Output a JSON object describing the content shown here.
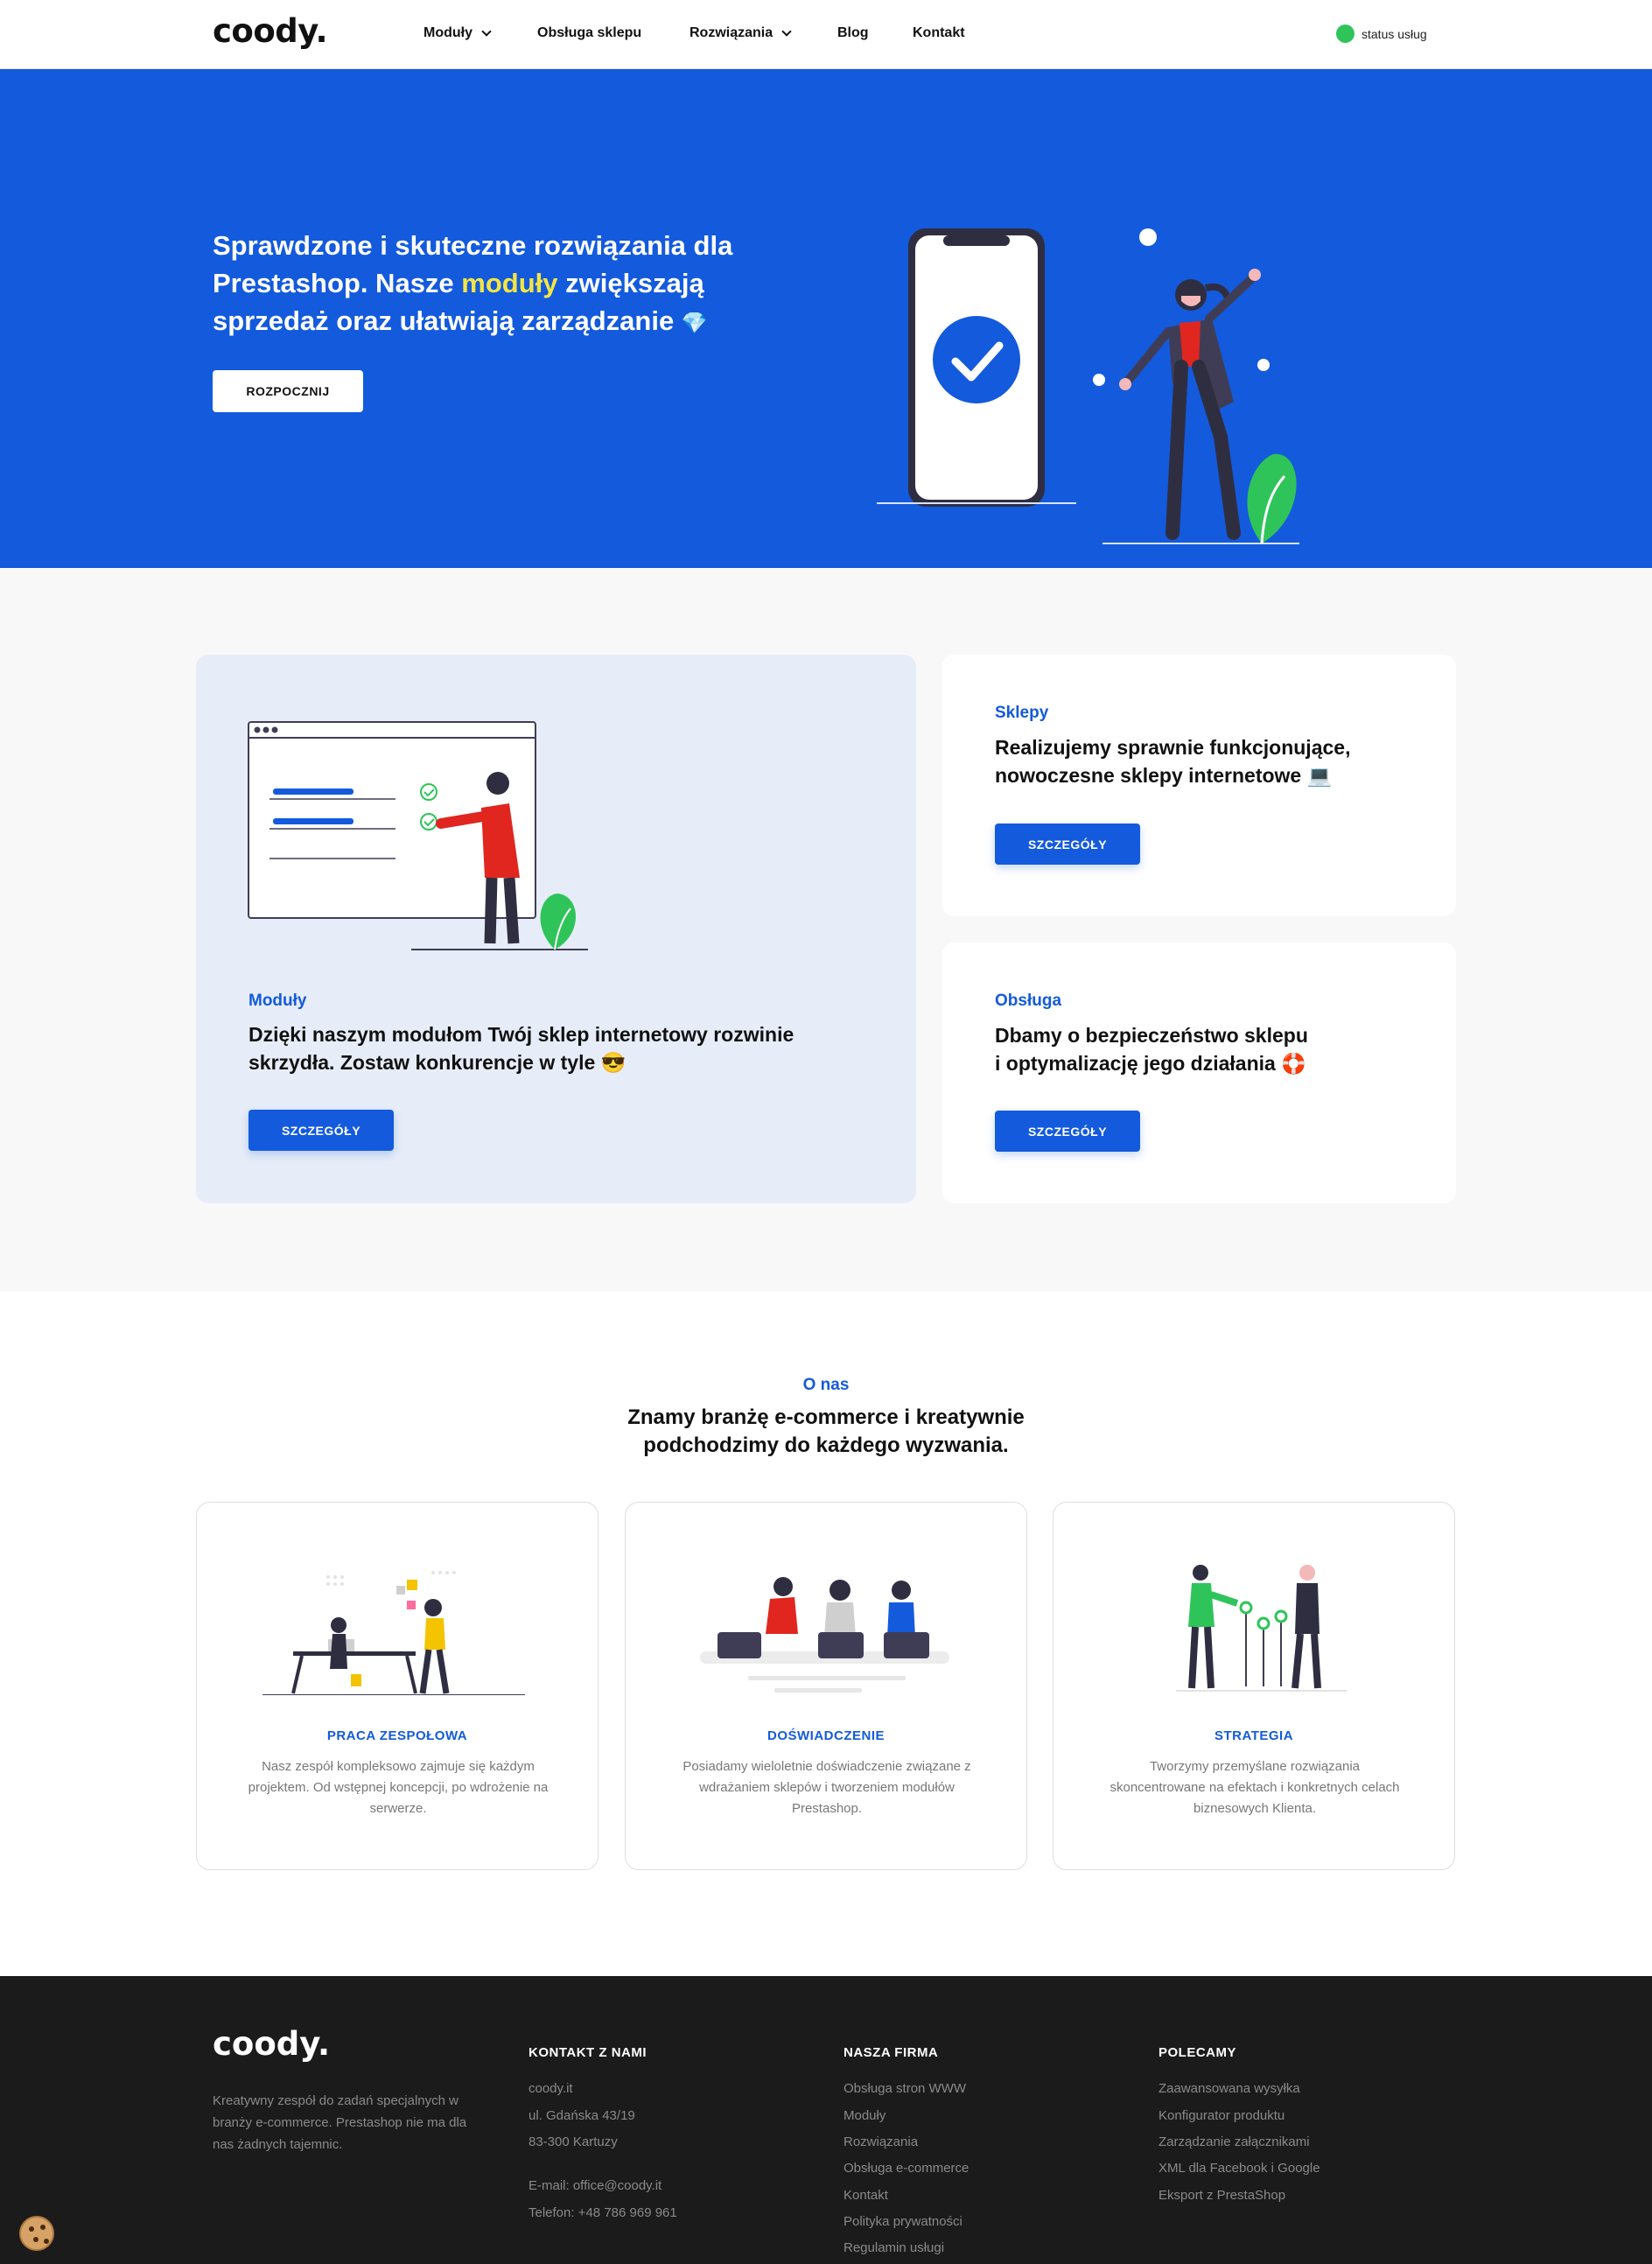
{
  "header": {
    "logo": "coody.",
    "nav": [
      {
        "label": "Moduły",
        "dropdown": true
      },
      {
        "label": "Obsługa sklepu",
        "dropdown": false
      },
      {
        "label": "Rozwiązania",
        "dropdown": true
      },
      {
        "label": "Blog",
        "dropdown": false
      },
      {
        "label": "Kontakt",
        "dropdown": false
      }
    ],
    "status_label": "status usług",
    "status_color": "#2fc45a"
  },
  "hero": {
    "line1": "Sprawdzone i skuteczne rozwiązania dla",
    "line2a": "Prestashop. Nasze ",
    "line2_highlight": "moduły",
    "line2b": " zwiększają",
    "line3": "sprzedaż oraz ułatwiają zarządzanie",
    "emoji": "💎",
    "cta": "ROZPOCZNIJ",
    "bg_color": "#135add",
    "highlight_color": "#f4e542"
  },
  "services": {
    "modules": {
      "tag": "Moduły",
      "line1": "Dzięki naszym modułom Twój sklep internetowy rozwinie",
      "line2": "skrzydła. Zostaw konkurencje w tyle",
      "emoji": "😎",
      "button": "SZCZEGÓŁY"
    },
    "shops": {
      "tag": "Sklepy",
      "line1": "Realizujemy sprawnie funkcjonujące,",
      "line2": "nowoczesne sklepy internetowe",
      "emoji": "💻",
      "button": "SZCZEGÓŁY"
    },
    "support": {
      "tag": "Obsługa",
      "line1": "Dbamy o bezpieczeństwo sklepu",
      "line2": "i optymalizację jego działania",
      "emoji": "🛟",
      "button": "SZCZEGÓŁY"
    }
  },
  "about": {
    "tag": "O nas",
    "heading_line1": "Znamy branżę e-commerce i kreatywnie",
    "heading_line2": "podchodzimy do każdego wyzwania.",
    "features": [
      {
        "title": "PRACA ZESPOŁOWA",
        "desc": "Nasz zespół kompleksowo zajmuje się każdym projektem. Od wstępnej koncepcji, po wdrożenie na serwerze."
      },
      {
        "title": "DOŚWIADCZENIE",
        "desc": "Posiadamy wieloletnie doświadczenie związane z wdrażaniem sklepów i tworzeniem modułów Prestashop."
      },
      {
        "title": "STRATEGIA",
        "desc": "Tworzymy przemyślane rozwiązania skoncentrowane na efektach i konkretnych celach biznesowych Klienta."
      }
    ]
  },
  "footer": {
    "logo": "coody.",
    "about": "Kreatywny zespół do zadań specjalnych w branży e-commerce. Prestashop nie ma dla nas żadnych tajemnic.",
    "contact": {
      "heading": "KONTAKT Z NAMI",
      "lines": [
        "coody.it",
        "ul. Gdańska 43/19",
        "83-300 Kartuzy"
      ],
      "email": "E-mail: office@coody.it",
      "phone": "Telefon: +48 786 969 961"
    },
    "company": {
      "heading": "NASZA FIRMA",
      "items": [
        "Obsługa stron WWW",
        "Moduły",
        "Rozwiązania",
        "Obsługa e-commerce",
        "Kontakt",
        "Polityka prywatności",
        "Regulamin usługi"
      ]
    },
    "recommended": {
      "heading": "POLECAMY",
      "items": [
        "Zaawansowana wysyłka",
        "Konfigurator produktu",
        "Zarządzanie załącznikami",
        "XML dla Facebook i Google",
        "Eksport z PrestaShop"
      ]
    }
  }
}
